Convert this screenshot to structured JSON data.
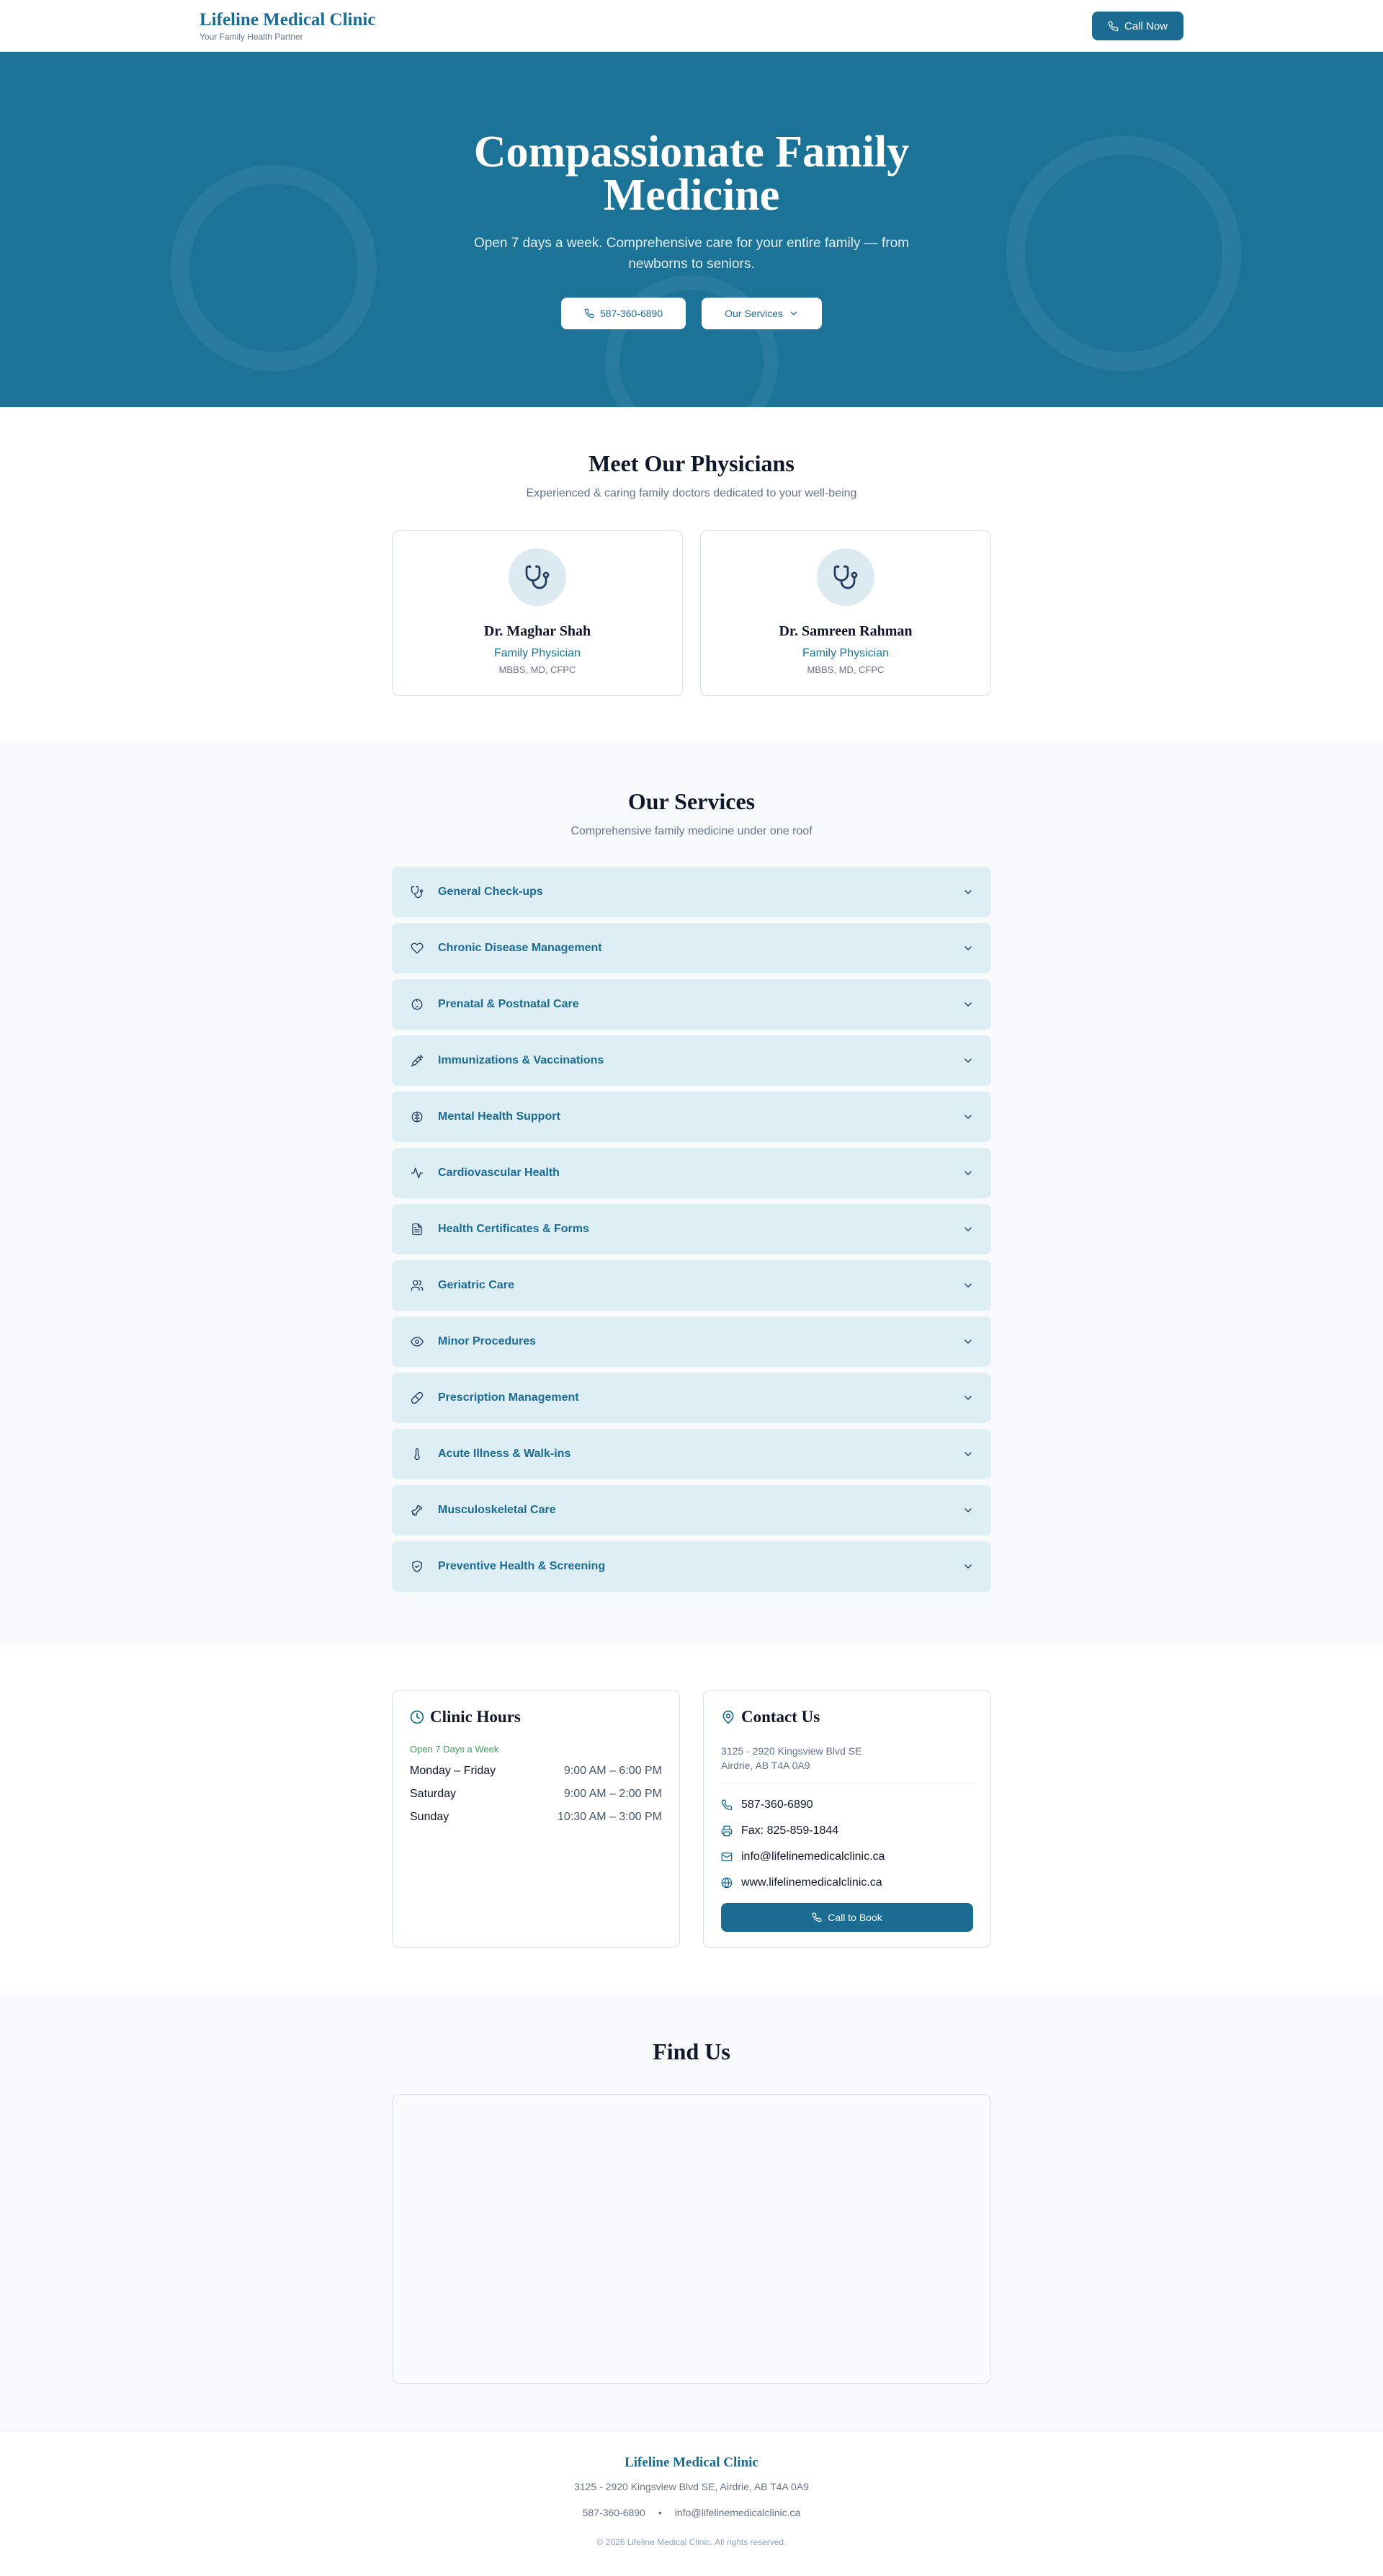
{
  "header": {
    "brand": "Lifeline Medical Clinic",
    "tagline": "Your Family Health Partner",
    "call_button": "Call Now"
  },
  "hero": {
    "title": "Compassionate Family Medicine",
    "subtitle": "Open 7 days a week. Comprehensive care for your entire family — from newborns to seniors.",
    "phone_button": "587-360-6890",
    "services_button": "Our Services"
  },
  "physicians": {
    "title": "Meet Our Physicians",
    "subtitle": "Experienced & caring family doctors dedicated to your well-being",
    "doctors": [
      {
        "name": "Dr. Maghar Shah",
        "role": "Family Physician",
        "credentials": "MBBS, MD, CFPC",
        "icon": "stethoscope-icon"
      },
      {
        "name": "Dr. Samreen Rahman",
        "role": "Family Physician",
        "credentials": "MBBS, MD, CFPC",
        "icon": "stethoscope-icon"
      }
    ]
  },
  "services": {
    "title": "Our Services",
    "subtitle": "Comprehensive family medicine under one roof",
    "items": [
      {
        "label": "General Check-ups",
        "icon": "stethoscope-icon"
      },
      {
        "label": "Chronic Disease Management",
        "icon": "heart-icon"
      },
      {
        "label": "Prenatal & Postnatal Care",
        "icon": "baby-icon"
      },
      {
        "label": "Immunizations & Vaccinations",
        "icon": "syringe-icon"
      },
      {
        "label": "Mental Health Support",
        "icon": "brain-icon"
      },
      {
        "label": "Cardiovascular Health",
        "icon": "pulse-icon"
      },
      {
        "label": "Health Certificates & Forms",
        "icon": "document-icon"
      },
      {
        "label": "Geriatric Care",
        "icon": "users-icon"
      },
      {
        "label": "Minor Procedures",
        "icon": "eye-icon"
      },
      {
        "label": "Prescription Management",
        "icon": "pill-icon"
      },
      {
        "label": "Acute Illness & Walk-ins",
        "icon": "thermometer-icon"
      },
      {
        "label": "Musculoskeletal Care",
        "icon": "bone-icon"
      },
      {
        "label": "Preventive Health & Screening",
        "icon": "shield-icon"
      }
    ]
  },
  "hours": {
    "title": "Clinic Hours",
    "note": "Open 7 Days a Week",
    "rows": [
      {
        "day": "Monday – Friday",
        "time": "9:00 AM – 6:00 PM"
      },
      {
        "day": "Saturday",
        "time": "9:00 AM – 2:00 PM"
      },
      {
        "day": "Sunday",
        "time": "10:30 AM – 3:00 PM"
      }
    ]
  },
  "contact": {
    "title": "Contact Us",
    "address_line1": "3125 - 2920 Kingsview Blvd SE",
    "address_line2": "Airdrie, AB T4A 0A9",
    "phone": "587-360-6890",
    "fax": "Fax: 825-859-1844",
    "email": "info@lifelinemedicalclinic.ca",
    "website": "www.lifelinemedicalclinic.ca",
    "book_button": "Call to Book"
  },
  "find": {
    "title": "Find Us"
  },
  "footer": {
    "brand": "Lifeline Medical Clinic",
    "address": "3125 - 2920 Kingsview Blvd SE, Airdrie, AB T4A 0A9",
    "phone": "587-360-6890",
    "separator": "•",
    "email": "info@lifelinemedicalclinic.ca",
    "copyright": "© 2026 Lifeline Medical Clinic. All rights reserved."
  },
  "colors": {
    "primary": "#1b6b93",
    "hero_bg": "#1b7497",
    "service_bg": "#ddeef5",
    "success": "#3a9a5e"
  }
}
